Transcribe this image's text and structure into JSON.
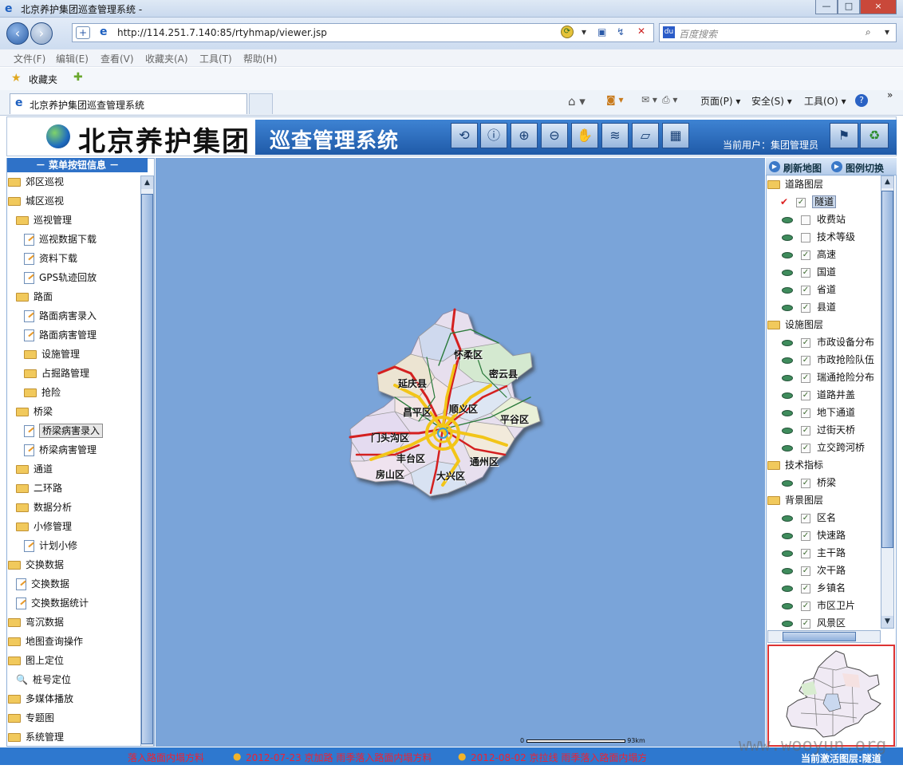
{
  "window": {
    "title": "北京养护集团巡查管理系统 -",
    "controls": [
      "—",
      "□",
      "×"
    ]
  },
  "browser": {
    "url": "http://114.251.7.140:85/rtyhmap/viewer.jsp",
    "search_placeholder": "百度搜索",
    "menu": [
      "文件(F)",
      "编辑(E)",
      "查看(V)",
      "收藏夹(A)",
      "工具(T)",
      "帮助(H)"
    ],
    "favorites_label": "收藏夹",
    "tab_title": "北京养护集团巡查管理系统",
    "commands": [
      "页面(P) ▾",
      "安全(S) ▾",
      "工具(O) ▾"
    ],
    "overflow": "»"
  },
  "app": {
    "company": "北京养护集团",
    "system": "巡查管理系统",
    "current_user": "当前用户：集团管理员",
    "tools": [
      "refresh-icon",
      "info-icon",
      "zoom-in-icon",
      "zoom-out-icon",
      "pan-hand-icon",
      "layers-icon",
      "eraser-icon",
      "grid-icon"
    ]
  },
  "left": {
    "header": "－ 菜单按钮信息 －",
    "items": [
      {
        "label": "郊区巡视",
        "type": "folder",
        "level": 0
      },
      {
        "label": "城区巡视",
        "type": "folder",
        "level": 0
      },
      {
        "label": "巡视管理",
        "type": "folder",
        "level": 1
      },
      {
        "label": "巡视数据下载",
        "type": "page",
        "level": 2
      },
      {
        "label": "资料下载",
        "type": "page",
        "level": 2
      },
      {
        "label": "GPS轨迹回放",
        "type": "page",
        "level": 2
      },
      {
        "label": "路面",
        "type": "folder",
        "level": 1
      },
      {
        "label": "路面病害录入",
        "type": "page",
        "level": 2
      },
      {
        "label": "路面病害管理",
        "type": "page",
        "level": 2
      },
      {
        "label": "设施管理",
        "type": "folder",
        "level": 2
      },
      {
        "label": "占掘路管理",
        "type": "folder",
        "level": 2
      },
      {
        "label": "抢险",
        "type": "folder",
        "level": 2
      },
      {
        "label": "桥梁",
        "type": "folder",
        "level": 1
      },
      {
        "label": "桥梁病害录入",
        "type": "page",
        "level": 2,
        "selected": true
      },
      {
        "label": "桥梁病害管理",
        "type": "page",
        "level": 2
      },
      {
        "label": "通道",
        "type": "folder",
        "level": 1
      },
      {
        "label": "二环路",
        "type": "folder",
        "level": 1
      },
      {
        "label": "数据分析",
        "type": "folder",
        "level": 1
      },
      {
        "label": "小修管理",
        "type": "folder",
        "level": 1
      },
      {
        "label": "计划小修",
        "type": "page",
        "level": 2
      },
      {
        "label": "交换数据",
        "type": "folder",
        "level": 0
      },
      {
        "label": "交换数据",
        "type": "page",
        "level": 1
      },
      {
        "label": "交换数据统计",
        "type": "page",
        "level": 1
      },
      {
        "label": "弯沉数据",
        "type": "folder",
        "level": 0
      },
      {
        "label": "地图查询操作",
        "type": "folder",
        "level": 0
      },
      {
        "label": "图上定位",
        "type": "folder",
        "level": 0
      },
      {
        "label": "桩号定位",
        "type": "search",
        "level": 1
      },
      {
        "label": "多媒体播放",
        "type": "folder",
        "level": 0
      },
      {
        "label": "专题图",
        "type": "folder",
        "level": 0
      },
      {
        "label": "系统管理",
        "type": "folder",
        "level": 0
      }
    ]
  },
  "map": {
    "districts": [
      "怀柔区",
      "密云县",
      "延庆县",
      "昌平区",
      "顺义区",
      "平谷区",
      "门头沟区",
      "丰台区",
      "通州区",
      "房山区",
      "大兴区"
    ],
    "scale_start": "0",
    "scale_end": "93km"
  },
  "right": {
    "refresh_btn": "刷新地图",
    "legend_btn": "图例切换",
    "groups": [
      {
        "name": "道路图层",
        "layers": [
          {
            "n": "隧道",
            "c": true,
            "sel": true
          },
          {
            "n": "收费站",
            "c": false
          },
          {
            "n": "技术等级",
            "c": false
          },
          {
            "n": "高速",
            "c": true
          },
          {
            "n": "国道",
            "c": true
          },
          {
            "n": "省道",
            "c": true
          },
          {
            "n": "县道",
            "c": true
          }
        ]
      },
      {
        "name": "设施图层",
        "layers": [
          {
            "n": "市政设备分布",
            "c": true
          },
          {
            "n": "市政抢险队伍",
            "c": true
          },
          {
            "n": "瑞通抢险分布",
            "c": true
          },
          {
            "n": "道路井盖",
            "c": true
          },
          {
            "n": "地下通道",
            "c": true
          },
          {
            "n": "过街天桥",
            "c": true
          },
          {
            "n": "立交跨河桥",
            "c": true
          }
        ]
      },
      {
        "name": "技术指标",
        "layers": [
          {
            "n": "桥梁",
            "c": true
          }
        ]
      },
      {
        "name": "背景图层",
        "layers": [
          {
            "n": "区名",
            "c": true
          },
          {
            "n": "快速路",
            "c": true
          },
          {
            "n": "主干路",
            "c": true
          },
          {
            "n": "次干路",
            "c": true
          },
          {
            "n": "乡镇名",
            "c": true
          },
          {
            "n": "市区卫片",
            "c": true
          },
          {
            "n": "风景区",
            "c": true
          }
        ]
      }
    ]
  },
  "status": {
    "news": [
      "落入路面内塌方料",
      "2012-07-23  京加路  雨季落入路面内塌方料",
      "2012-08-02  京拉线  雨季落入路面内塌方料"
    ],
    "current_layer": "当前激活图层:隧道"
  },
  "watermark": "www.wooyun.org",
  "colors": {
    "header_blue": "#1f5aa8",
    "map_bg": "#7aa4d9",
    "status_bg": "#2e78cf",
    "news_red": "#e22233"
  }
}
